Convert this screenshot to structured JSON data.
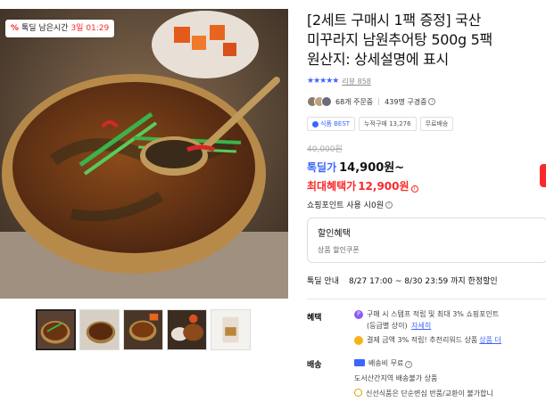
{
  "deal_badge": {
    "icon": "percent-icon",
    "prefix": "%",
    "label": "톡딜 남은시간",
    "countdown": "3일 01:29"
  },
  "product": {
    "title_line1": "[2세트 구매시 1팩 증정] 국산",
    "title_line2": "미꾸라지 남원추어탕 500g 5팩",
    "title_line3": "원산지: 상세설명에 표시",
    "stars": "★★★★★",
    "review_label": "리뷰 858",
    "orders": "68개 주문중",
    "watchers": "439명 구경중",
    "tags": {
      "best": "식품 BEST",
      "cumulative_label": "누적구매",
      "cumulative_value": "13,276",
      "shipping": "무료배송"
    },
    "original_price": "40,000원",
    "sale_label": "톡딜가",
    "sale_price": "14,900원~",
    "max_label": "최대혜택가",
    "max_price": "12,900원",
    "points_label": "쇼핑포인트 사용 시0원"
  },
  "coupon": {
    "title": "할인혜택",
    "sub": "상품 할인쿠폰"
  },
  "promo": {
    "label": "톡딜 안내",
    "text": "8/27 17:00 ~ 8/30 23:59 까지 한정할인"
  },
  "benefit": {
    "label": "혜택",
    "line1": "구매 시 스탬프 적립 및 최대 3% 쇼핑포인트",
    "line2": "(등급별 상이)",
    "detail_link": "자세히",
    "line3": "결제 금액 3% 적립! 추천리워드 상품",
    "line3_link": "상품 더"
  },
  "shipping": {
    "label": "배송",
    "fee": "배송비 무료",
    "remote": "도서산간지역 배송불가 상품",
    "notice": "신선식품은 단순변심 반품/교환이 불가합니"
  },
  "colors": {
    "accent_blue": "#3e64ff",
    "accent_red": "#fa2828"
  }
}
